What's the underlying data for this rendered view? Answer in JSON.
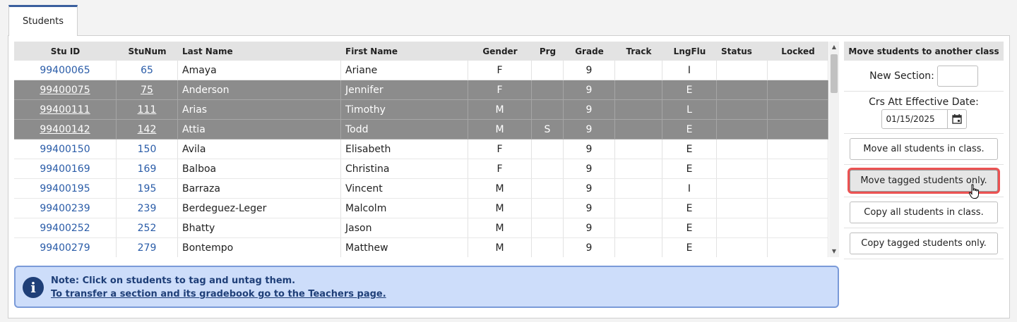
{
  "tabs": [
    {
      "label": "Students"
    }
  ],
  "table": {
    "columns": [
      "Stu ID",
      "StuNum",
      "Last Name",
      "First Name",
      "Gender",
      "Prg",
      "Grade",
      "Track",
      "LngFlu",
      "Status",
      "Locked"
    ],
    "rows": [
      {
        "stu_id": "99400065",
        "stu_num": "65",
        "last": "Amaya",
        "first": "Ariane",
        "gender": "F",
        "prg": "",
        "grade": "9",
        "track": "",
        "lngflu": "I",
        "status": "",
        "locked": "",
        "tagged": false
      },
      {
        "stu_id": "99400075",
        "stu_num": "75",
        "last": "Anderson",
        "first": "Jennifer",
        "gender": "F",
        "prg": "",
        "grade": "9",
        "track": "",
        "lngflu": "E",
        "status": "",
        "locked": "",
        "tagged": true
      },
      {
        "stu_id": "99400111",
        "stu_num": "111",
        "last": "Arias",
        "first": "Timothy",
        "gender": "M",
        "prg": "",
        "grade": "9",
        "track": "",
        "lngflu": "L",
        "status": "",
        "locked": "",
        "tagged": true
      },
      {
        "stu_id": "99400142",
        "stu_num": "142",
        "last": "Attia",
        "first": "Todd",
        "gender": "M",
        "prg": "S",
        "grade": "9",
        "track": "",
        "lngflu": "E",
        "status": "",
        "locked": "",
        "tagged": true
      },
      {
        "stu_id": "99400150",
        "stu_num": "150",
        "last": "Avila",
        "first": "Elisabeth",
        "gender": "F",
        "prg": "",
        "grade": "9",
        "track": "",
        "lngflu": "E",
        "status": "",
        "locked": "",
        "tagged": false
      },
      {
        "stu_id": "99400169",
        "stu_num": "169",
        "last": "Balboa",
        "first": "Christina",
        "gender": "F",
        "prg": "",
        "grade": "9",
        "track": "",
        "lngflu": "E",
        "status": "",
        "locked": "",
        "tagged": false
      },
      {
        "stu_id": "99400195",
        "stu_num": "195",
        "last": "Barraza",
        "first": "Vincent",
        "gender": "M",
        "prg": "",
        "grade": "9",
        "track": "",
        "lngflu": "I",
        "status": "",
        "locked": "",
        "tagged": false
      },
      {
        "stu_id": "99400239",
        "stu_num": "239",
        "last": "Berdeguez-Leger",
        "first": "Malcolm",
        "gender": "M",
        "prg": "",
        "grade": "9",
        "track": "",
        "lngflu": "E",
        "status": "",
        "locked": "",
        "tagged": false
      },
      {
        "stu_id": "99400252",
        "stu_num": "252",
        "last": "Bhatty",
        "first": "Jason",
        "gender": "M",
        "prg": "",
        "grade": "9",
        "track": "",
        "lngflu": "E",
        "status": "",
        "locked": "",
        "tagged": false
      },
      {
        "stu_id": "99400279",
        "stu_num": "279",
        "last": "Bontempo",
        "first": "Matthew",
        "gender": "M",
        "prg": "",
        "grade": "9",
        "track": "",
        "lngflu": "E",
        "status": "",
        "locked": "",
        "tagged": false
      }
    ]
  },
  "note": {
    "title": "Note: Click on students to tag and untag them.",
    "link": "To transfer a section and its gradebook go to the Teachers page."
  },
  "side": {
    "header": "Move students to another class",
    "new_section_label": "New Section:",
    "new_section_value": "",
    "date_label": "Crs Att Effective Date:",
    "date_value": "01/15/2025",
    "buttons": {
      "move_all": "Move all students in class.",
      "move_tagged": "Move tagged students only.",
      "copy_all": "Copy all students in class.",
      "copy_tagged": "Copy tagged students only."
    }
  },
  "colors": {
    "accent": "#3a5f9e",
    "link": "#2a5ca8",
    "selected_row": "#8c8c8c",
    "note_bg": "#cdddfa",
    "highlight": "#ec5252"
  }
}
